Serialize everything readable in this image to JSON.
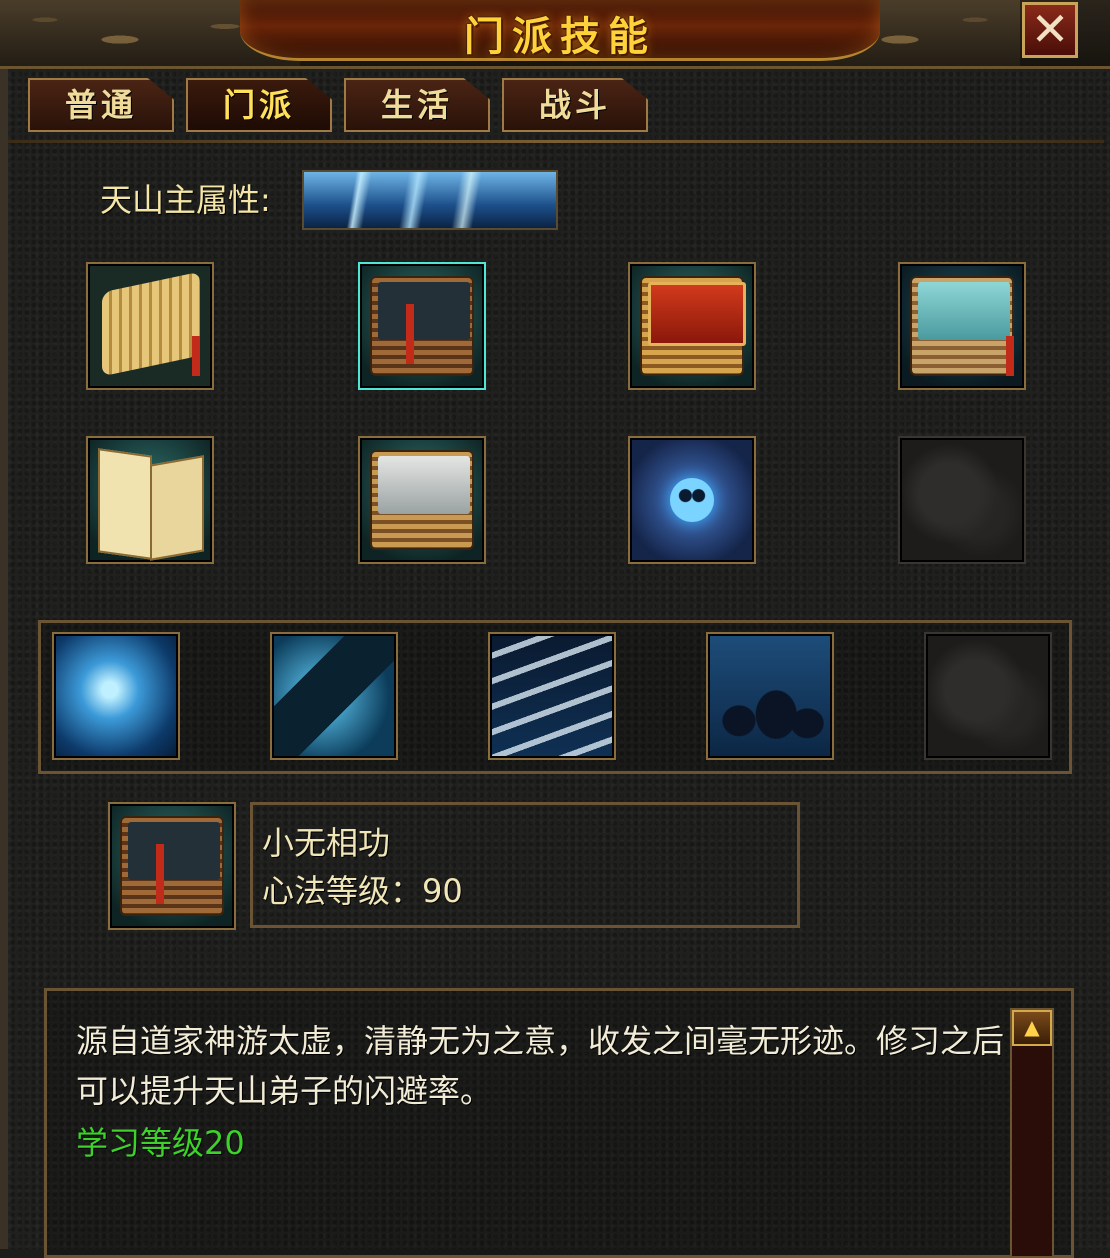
{
  "window": {
    "title": "门派技能",
    "close_label": "✕"
  },
  "tabs": [
    {
      "label": "普通",
      "active": false
    },
    {
      "label": "门派",
      "active": true
    },
    {
      "label": "生活",
      "active": false
    },
    {
      "label": "战斗",
      "active": false
    }
  ],
  "attribute": {
    "label": "天山主属性:"
  },
  "skill_books": [
    {
      "icon": "bamboo-scroll-icon"
    },
    {
      "icon": "dark-book-icon",
      "selected": true
    },
    {
      "icon": "red-manual-icon"
    },
    {
      "icon": "blue-bound-book-icon"
    },
    {
      "icon": "open-manual-icon"
    },
    {
      "icon": "grey-book-icon"
    },
    {
      "icon": "skull-scroll-icon"
    },
    {
      "icon": "empty-slot"
    }
  ],
  "active_skills": [
    {
      "icon": "ice-swirl-icon"
    },
    {
      "icon": "ice-kick-icon"
    },
    {
      "icon": "snow-slope-icon"
    },
    {
      "icon": "shadow-figures-icon"
    },
    {
      "icon": "empty-slot"
    }
  ],
  "selected_skill": {
    "name": "小无相功",
    "level_text": "心法等级：90"
  },
  "description": {
    "text": "源自道家神游太虚，清静无为之意，收发之间毫无形迹。修习之后可以提升天山弟子的闪避率。",
    "requirement": "学习等级20"
  },
  "colors": {
    "title": "#ffd23a",
    "tab_text": "#f0dc9a",
    "requirement": "#3cd22a",
    "selected_border": "#4fe6d6"
  }
}
